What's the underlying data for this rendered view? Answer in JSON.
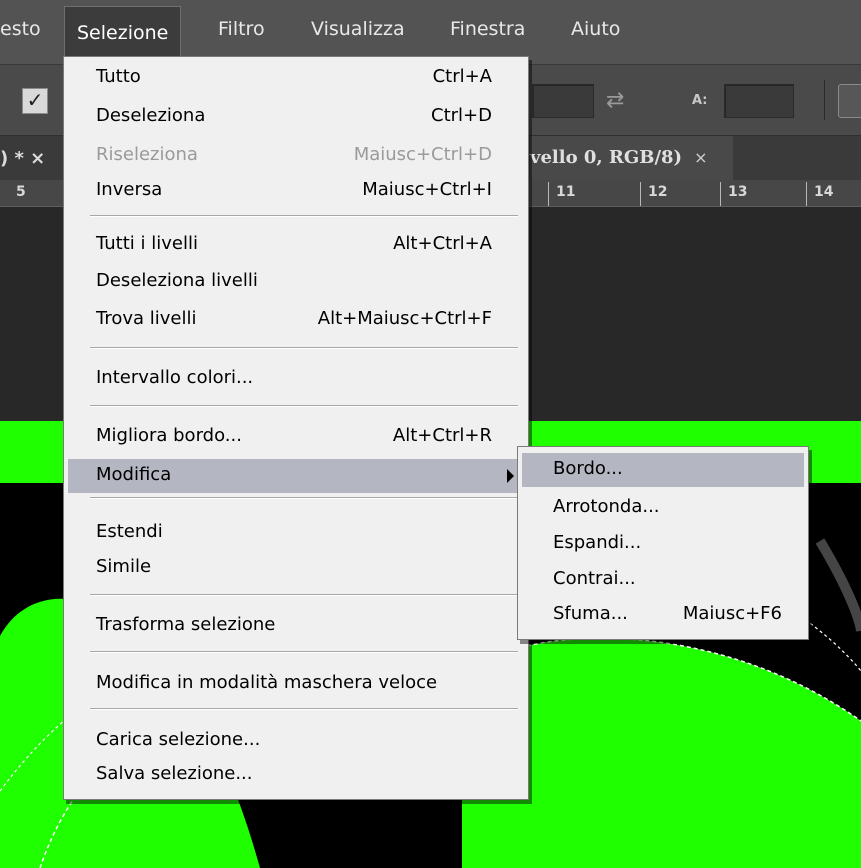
{
  "menubar": {
    "items": [
      "esto",
      "Selezione",
      "Filtro",
      "Visualizza",
      "Finestra",
      "Aiuto"
    ],
    "active": "Selezione"
  },
  "optionsbar": {
    "checkbox_checked": true,
    "field_label_a": "A:",
    "swap_icon": "swap-arrows-icon"
  },
  "tabs": {
    "left_tab_fragment": ") * ×",
    "active_tab": "vello 0, RGB/8)",
    "close_glyph": "×"
  },
  "ruler": {
    "labels": [
      "5",
      "11",
      "12",
      "13",
      "14"
    ]
  },
  "menu": {
    "items": [
      {
        "label": "Tutto",
        "shortcut": "Ctrl+A"
      },
      {
        "label": "Deseleziona",
        "shortcut": "Ctrl+D"
      },
      {
        "label": "Riseleziona",
        "shortcut": "Maiusc+Ctrl+D",
        "disabled": true
      },
      {
        "label": "Inversa",
        "shortcut": "Maiusc+Ctrl+I"
      },
      {
        "label": "Tutti i livelli",
        "shortcut": "Alt+Ctrl+A"
      },
      {
        "label": "Deseleziona livelli",
        "shortcut": ""
      },
      {
        "label": "Trova livelli",
        "shortcut": "Alt+Maiusc+Ctrl+F"
      },
      {
        "label": "Intervallo colori...",
        "shortcut": ""
      },
      {
        "label": "Migliora bordo...",
        "shortcut": "Alt+Ctrl+R"
      },
      {
        "label": "Modifica",
        "shortcut": "",
        "submenu": true,
        "highlighted": true
      },
      {
        "label": "Estendi",
        "shortcut": ""
      },
      {
        "label": "Simile",
        "shortcut": ""
      },
      {
        "label": "Trasforma selezione",
        "shortcut": ""
      },
      {
        "label": "Modifica in modalità maschera veloce",
        "shortcut": ""
      },
      {
        "label": "Carica selezione...",
        "shortcut": ""
      },
      {
        "label": "Salva selezione...",
        "shortcut": ""
      }
    ]
  },
  "submenu": {
    "items": [
      {
        "label": "Bordo...",
        "shortcut": "",
        "highlighted": true
      },
      {
        "label": "Arrotonda...",
        "shortcut": ""
      },
      {
        "label": "Espandi...",
        "shortcut": ""
      },
      {
        "label": "Contrai...",
        "shortcut": ""
      },
      {
        "label": "Sfuma...",
        "shortcut": "Maiusc+F6"
      }
    ]
  },
  "colors": {
    "canvas_green": "#1fff00",
    "menu_bg": "#f0f0f0",
    "highlight": "#b4b6c2",
    "app_bg": "#535353"
  }
}
